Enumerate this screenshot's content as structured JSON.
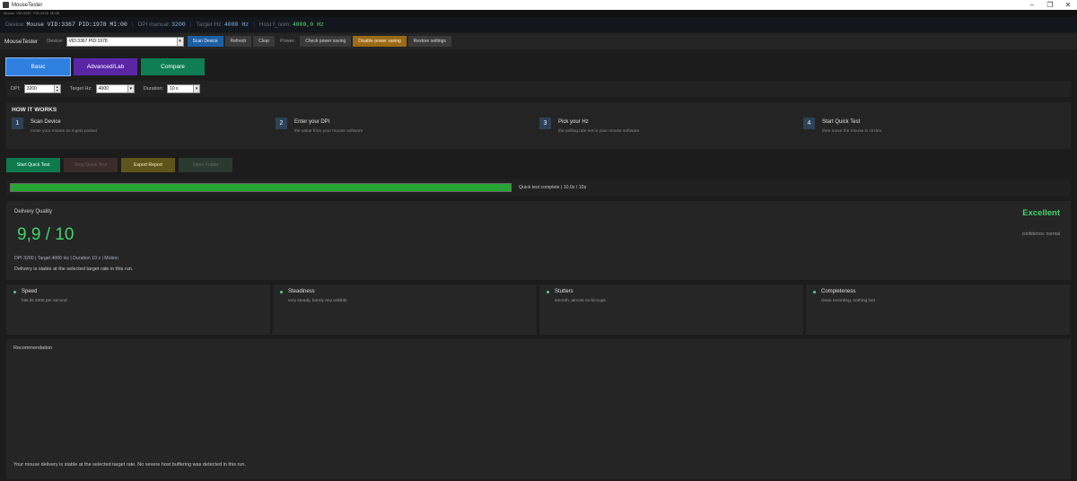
{
  "window": {
    "title": "MouseTester",
    "sub_status": "Mouse  VID:3367  PID:1978  MI:00"
  },
  "status_strip": {
    "device_label": "Device:",
    "device_value": "Mouse",
    "vid": "VID:3367",
    "pid": "PID:1978",
    "mi": "MI:00",
    "dpi_label": "DPI manual:",
    "dpi_value": "3200",
    "target_label": "Target Hz:",
    "target_value": "4000 Hz",
    "host_label": "Host f_nom:",
    "host_value": "4000,0 Hz"
  },
  "toolbar": {
    "app_title": "MouseTester",
    "device_label": "Device:",
    "device_value": "VID:3367 PID:1978",
    "scan_label": "Scan Device",
    "refresh_label": "Refresh",
    "clear_label": "Clear",
    "power_label": "Power:",
    "check_power_label": "Check power saving",
    "disable_power_label": "Disable power saving",
    "restore_label": "Restore settings"
  },
  "tabs": [
    {
      "label": "Basic"
    },
    {
      "label": "Advanced/Lab"
    },
    {
      "label": "Compare"
    }
  ],
  "params": {
    "dpi_label": "DPI:",
    "dpi_value": "3200",
    "target_label": "Target Hz:",
    "target_value": "4000",
    "duration_label": "Duration:",
    "duration_value": "10 s"
  },
  "how": {
    "title": "HOW IT WORKS",
    "steps": [
      {
        "num": "1",
        "title": "Scan Device",
        "desc": "move your mouse so it gets picked"
      },
      {
        "num": "2",
        "title": "Enter your DPI",
        "desc": "the value from your mouse software"
      },
      {
        "num": "3",
        "title": "Pick your Hz",
        "desc": "the polling rate set in your mouse software"
      },
      {
        "num": "4",
        "title": "Start Quick Test",
        "desc": "then move the mouse in circles"
      }
    ]
  },
  "actions": {
    "start": "Start Quick Test",
    "stop": "Stop Quick Test",
    "export": "Export Report",
    "open": "Open Folder"
  },
  "progress": {
    "fraction": 1.0,
    "text": "Quick test complete  |  10,0s / 10s"
  },
  "quality": {
    "label": "Delivery Quality",
    "score": "9,9 / 10",
    "verdict": "Excellent",
    "confidence": "confidence: normal",
    "meta": "DPI 3200 | Target 4000 Hz | Duration 10 s | Motion",
    "message": "Delivery is stable at the selected target rate in this run."
  },
  "metrics": [
    {
      "title": "Speed",
      "desc": "hits its 4000 per second"
    },
    {
      "title": "Steadiness",
      "desc": "very steady, barely any wobble"
    },
    {
      "title": "Stutters",
      "desc": "smooth, almost no hiccups"
    },
    {
      "title": "Completeness",
      "desc": "clean recording, nothing lost"
    }
  ],
  "recommendation": {
    "label": "Recommendation",
    "text": "Your mouse delivery is stable at the selected target rate. No severe host buffering was detected in this run."
  },
  "colors": {
    "accent_green": "#43d36a",
    "tab_basic": "#2f7fe0",
    "tab_advanced": "#5b26a6",
    "tab_compare": "#0f7d56",
    "progress_fill": "#27a534"
  }
}
